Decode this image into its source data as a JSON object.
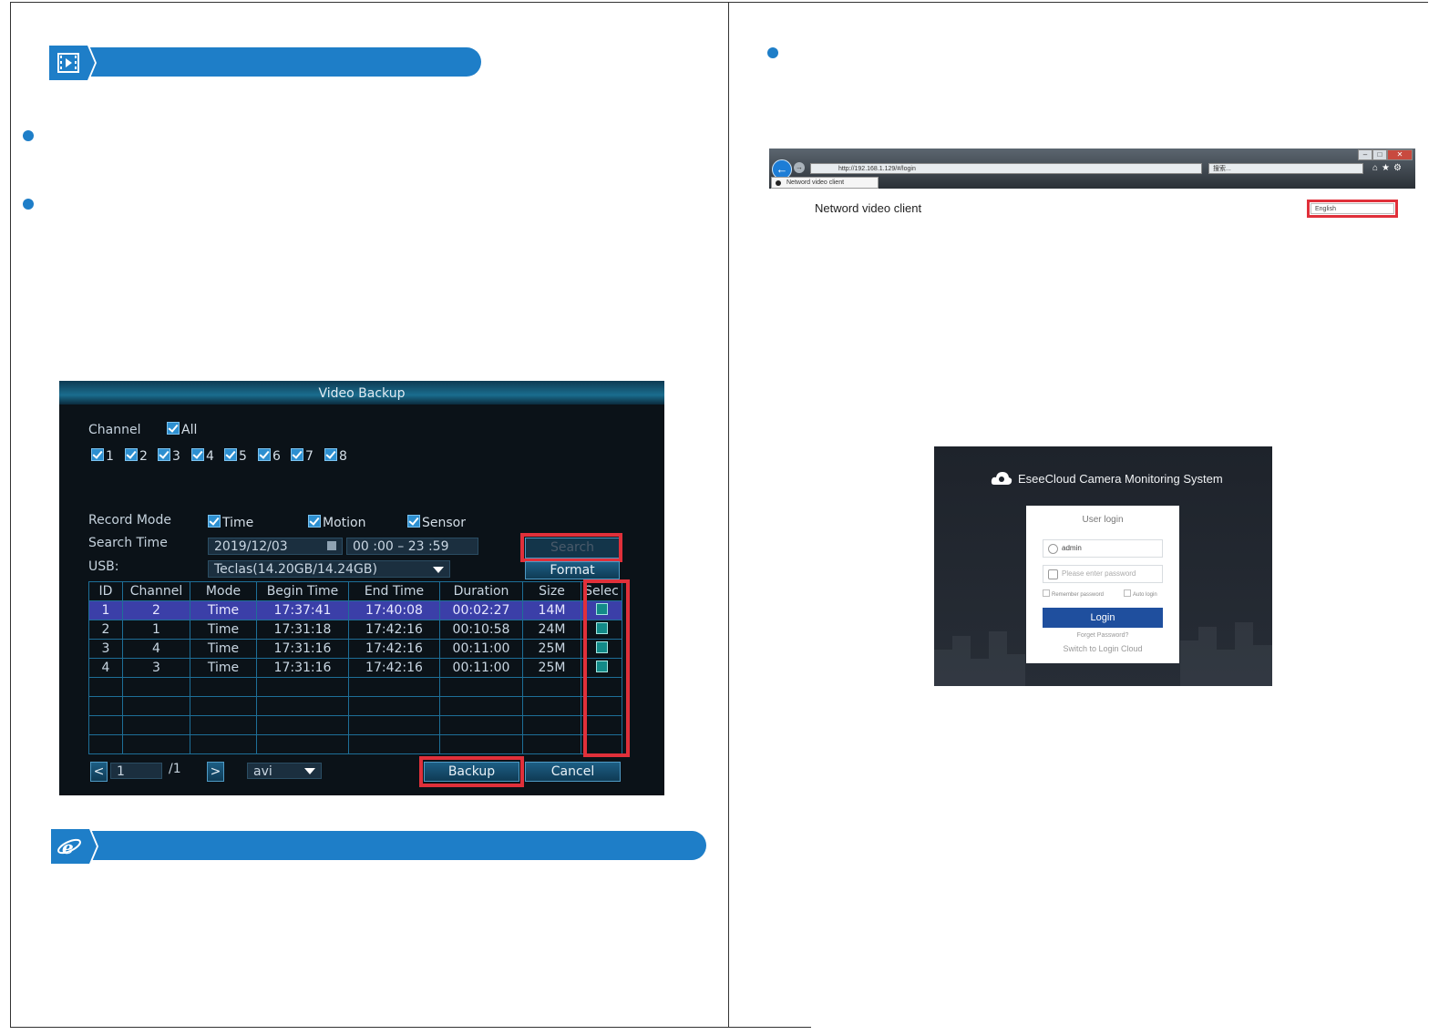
{
  "dvr": {
    "title": "Video Backup",
    "channel_label": "Channel",
    "all_label": "All",
    "channels": [
      "1",
      "2",
      "3",
      "4",
      "5",
      "6",
      "7",
      "8"
    ],
    "record_mode_label": "Record Mode",
    "modes": [
      "Time",
      "Motion",
      "Sensor"
    ],
    "search_time_label": "Search Time",
    "search_date": "2019/12/03",
    "search_time_range": "00 :00 – 23 :59",
    "search_button": "Search",
    "usb_label": "USB:",
    "usb_value": "Teclas(14.20GB/14.24GB)",
    "format_button": "Format",
    "columns": [
      "ID",
      "Channel",
      "Mode",
      "Begin Time",
      "End Time",
      "Duration",
      "Size",
      "Selec"
    ],
    "rows": [
      [
        "1",
        "2",
        "Time",
        "17:37:41",
        "17:40:08",
        "00:02:27",
        "14M"
      ],
      [
        "2",
        "1",
        "Time",
        "17:31:18",
        "17:42:16",
        "00:10:58",
        "24M"
      ],
      [
        "3",
        "4",
        "Time",
        "17:31:16",
        "17:42:16",
        "00:11:00",
        "25M"
      ],
      [
        "4",
        "3",
        "Time",
        "17:31:16",
        "17:42:16",
        "00:11:00",
        "25M"
      ]
    ],
    "page_current": "1",
    "page_total": "/1",
    "file_format": "avi",
    "backup_button": "Backup",
    "cancel_button": "Cancel"
  },
  "browser": {
    "url": "http://192.168.1.129/#/login",
    "search_placeholder": "搜索...",
    "tab_title": "Netword video client",
    "page_title": "Netword video client",
    "language": "English"
  },
  "login": {
    "brand": "EseeCloud Camera Monitoring System",
    "heading": "User login",
    "username_value": "admin",
    "password_placeholder": "Please enter password",
    "remember_label": "Remember password",
    "auto_login_label": "Auto login",
    "login_button": "Login",
    "forgot_link": "Forget Password?",
    "switch_link": "Switch to Login Cloud"
  },
  "colors": {
    "accent": "#1e7ec8",
    "highlight": "#e0303a",
    "dvr_bg": "#0b1218"
  },
  "icons": {
    "section1": "video-playback-icon",
    "section2": "internet-explorer-icon"
  }
}
